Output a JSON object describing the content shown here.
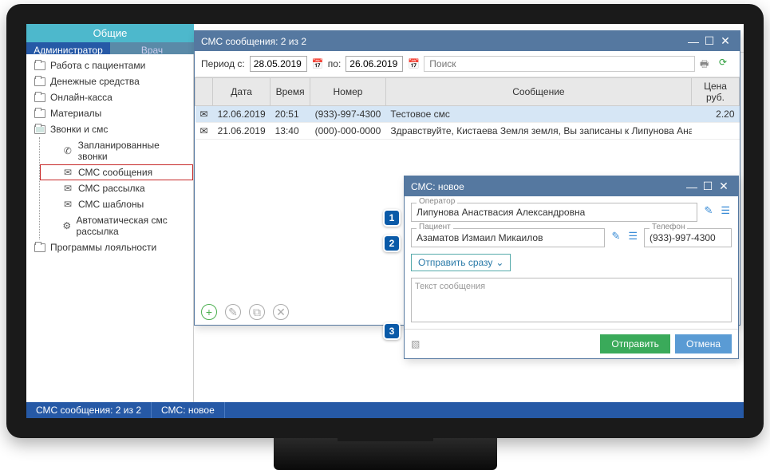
{
  "tabs": {
    "general": "Общие",
    "admin": "Администратор",
    "doctor": "Врач"
  },
  "sidebar": {
    "patients": "Работа с пациентами",
    "money": "Денежные средства",
    "online_kassa": "Онлайн-касса",
    "materials": "Материалы",
    "calls_sms": "Звонки и смс",
    "planned_calls": "Запланированные звонки",
    "sms_messages": "СМС сообщения",
    "sms_mailing": "СМС рассылка",
    "sms_templates": "СМС шаблоны",
    "auto_sms": "Автоматическая смс рассылка",
    "loyalty": "Программы лояльности"
  },
  "sms_window": {
    "title": "СМС сообщения: 2 из 2",
    "period_from": "Период с:",
    "date_from": "28.05.2019",
    "to": "по:",
    "date_to": "26.06.2019",
    "search_placeholder": "Поиск",
    "cols": {
      "date": "Дата",
      "time": "Время",
      "number": "Номер",
      "message": "Сообщение",
      "price": "Цена руб."
    },
    "rows": [
      {
        "date": "12.06.2019",
        "time": "20:51",
        "number": "(933)-997-4300",
        "msg": "Тестовое смс",
        "price": "2.20",
        "env": "blue"
      },
      {
        "date": "21.06.2019",
        "time": "13:40",
        "number": "(000)-000-0000",
        "msg": "Здравствуйте, Кистаева Земля земля, Вы записаны к Липунова Анаствасия Алексан,",
        "price": "",
        "env": "red"
      }
    ]
  },
  "new_sms": {
    "title": "СМС: новое",
    "operator_label": "Оператор",
    "operator": "Липунова Анаствасия Александровна",
    "patient_label": "Пациент",
    "patient": "Азаматов Измаил Микаилов",
    "phone_label": "Телефон",
    "phone": "(933)-997-4300",
    "send_mode": "Отправить сразу",
    "text_placeholder": "Текст сообщения",
    "send_btn": "Отправить",
    "cancel_btn": "Отмена"
  },
  "callouts": {
    "c1": "1",
    "c2": "2",
    "c3": "3"
  },
  "status": {
    "s1": "СМС сообщения: 2 из 2",
    "s2": "СМС: новое"
  }
}
